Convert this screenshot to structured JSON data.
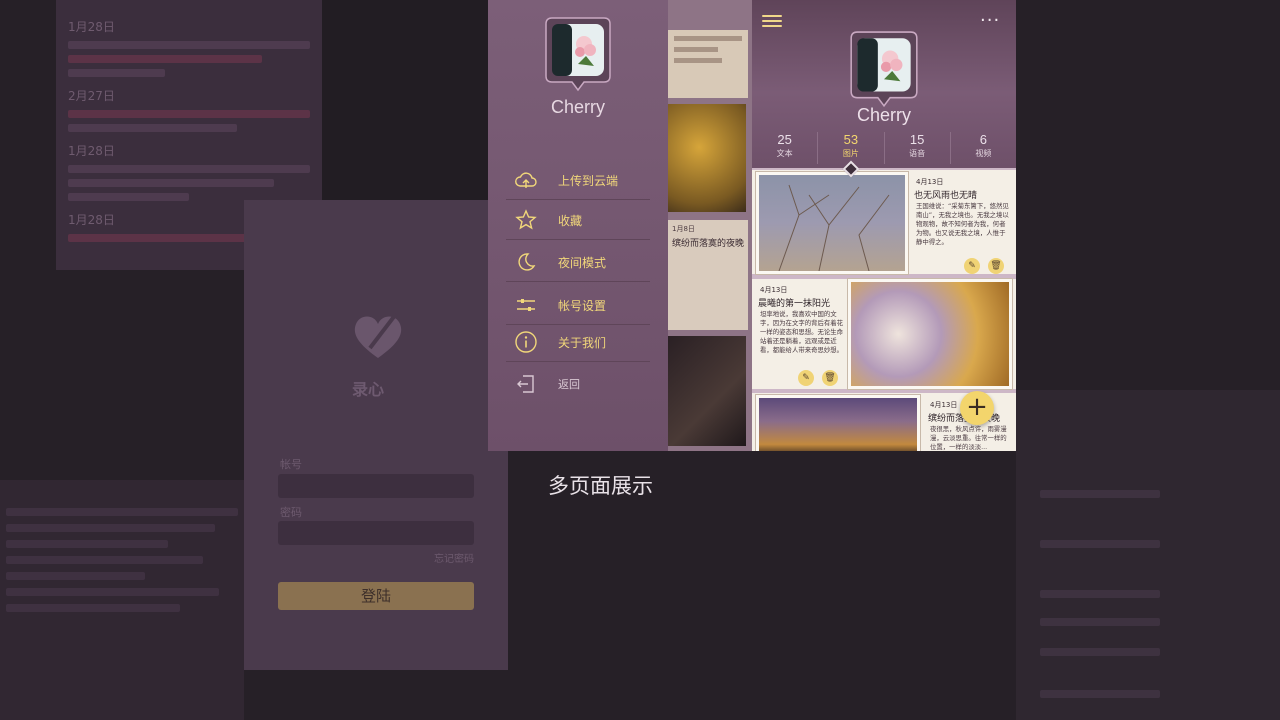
{
  "drawer": {
    "user_name": "Cherry",
    "menu": [
      {
        "label": "上传到云端",
        "icon": "cloud-upload-icon"
      },
      {
        "label": "收藏",
        "icon": "star-icon"
      },
      {
        "label": "夜间模式",
        "icon": "moon-icon"
      },
      {
        "label": "帐号设置",
        "icon": "sliders-icon"
      },
      {
        "label": "关于我们",
        "icon": "info-icon"
      },
      {
        "label": "返回",
        "icon": "back-arrow-icon"
      }
    ]
  },
  "peek": {
    "mid_date": "1月8日",
    "mid_title": "缤纷而落寞的夜晚"
  },
  "main": {
    "user_name": "Cherry",
    "menu_icon": "hamburger-menu-icon",
    "more_icon": "more-dots-icon",
    "more_glyph": "···",
    "stats": [
      {
        "count": "25",
        "label": "文本"
      },
      {
        "count": "53",
        "label": "图片"
      },
      {
        "count": "15",
        "label": "语音"
      },
      {
        "count": "6",
        "label": "视频"
      }
    ],
    "entries": [
      {
        "date": "4月13日",
        "title": "也无风雨也无晴",
        "body": "王国维说：“采菊东篱下，悠然见南山”，无我之境也。无我之境以物观物，故不知何者为我，何者为物。也又说无我之境，人惟于静中得之。"
      },
      {
        "date": "4月13日",
        "title": "晨曦的第一抹阳光",
        "body": "坦率地说，我喜欢中国的文字，因为在文字的背后有着花一样的姿态和思想。无论生命站着还是躺着，远观或是近看，都能给人带来奇思妙想。"
      },
      {
        "date": "4月13日",
        "title": "缤纷而落寞的夜晚",
        "body": "夜很黑，秋风点许，雨雾漫漫，云淡思重。往常一样的位置，一样的淡淡..."
      }
    ],
    "fab_label": "+",
    "edit_glyph": "✎",
    "delete_glyph": "🗑"
  },
  "background": {
    "diary_dates": [
      "1月28日",
      "2月27日",
      "1月28日",
      "1月28日"
    ],
    "logo_text": "录心",
    "field_labels": [
      "帐号",
      "密码"
    ],
    "forgot_label": "忘记密码",
    "login_button": "登陆"
  },
  "caption": "多页面展示"
}
